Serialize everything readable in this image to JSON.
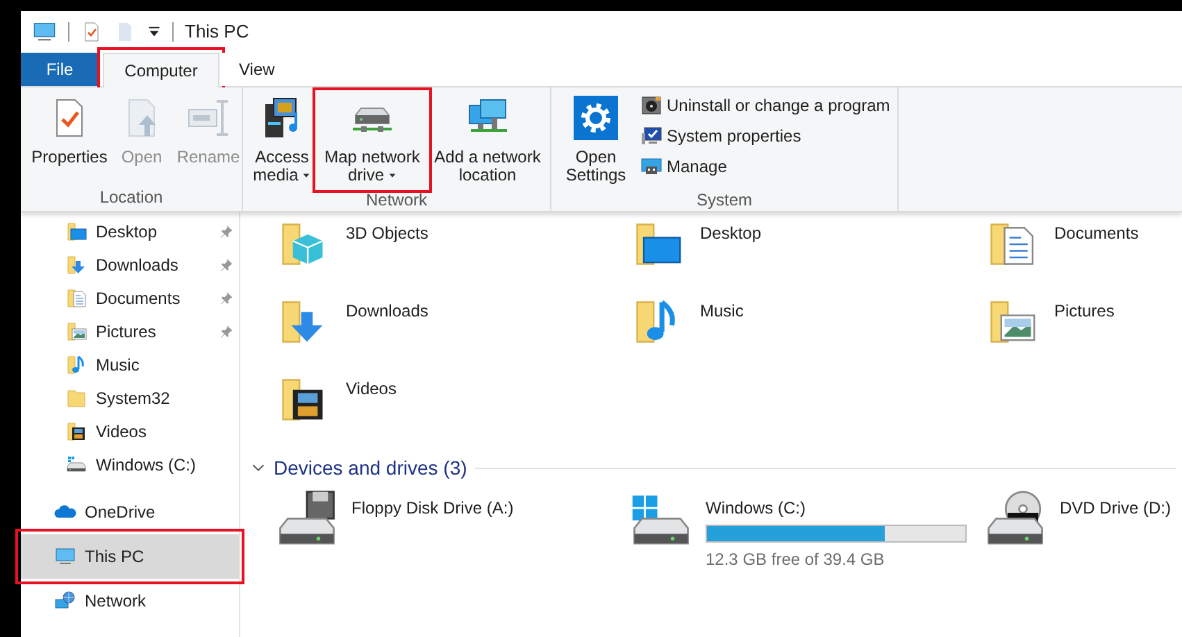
{
  "window": {
    "title": "This PC"
  },
  "tabs": [
    {
      "label": "File",
      "kind": "file",
      "selected": false,
      "highlighted": false
    },
    {
      "label": "Computer",
      "kind": "tab",
      "selected": true,
      "highlighted": true
    },
    {
      "label": "View",
      "kind": "tab",
      "selected": false,
      "highlighted": false
    }
  ],
  "ribbon_groups": [
    {
      "label": "Location",
      "commands": [
        {
          "label": "Properties",
          "kind": "large",
          "disabled": false,
          "dropdown": false,
          "highlighted": false
        },
        {
          "label": "Open",
          "kind": "large",
          "disabled": true,
          "dropdown": false,
          "highlighted": false
        },
        {
          "label": "Rename",
          "kind": "large",
          "disabled": true,
          "dropdown": false,
          "highlighted": false
        }
      ]
    },
    {
      "label": "Network",
      "commands": [
        {
          "label": "Access media",
          "kind": "large",
          "disabled": false,
          "dropdown": true,
          "highlighted": false
        },
        {
          "label": "Map network drive",
          "kind": "large",
          "disabled": false,
          "dropdown": true,
          "highlighted": true
        },
        {
          "label": "Add a network location",
          "kind": "large",
          "disabled": false,
          "dropdown": false,
          "highlighted": false
        }
      ]
    },
    {
      "label": "System",
      "commands": [
        {
          "label": "Open Settings",
          "kind": "large",
          "disabled": false,
          "dropdown": false,
          "highlighted": false
        },
        {
          "label": "Uninstall or change a program",
          "kind": "small",
          "disabled": false,
          "dropdown": false,
          "highlighted": false
        },
        {
          "label": "System properties",
          "kind": "small",
          "disabled": false,
          "dropdown": false,
          "highlighted": false
        },
        {
          "label": "Manage",
          "kind": "small",
          "disabled": false,
          "dropdown": false,
          "highlighted": false
        }
      ]
    }
  ],
  "navigation": {
    "quick_access": [
      {
        "label": "Desktop",
        "pinned": true
      },
      {
        "label": "Downloads",
        "pinned": true
      },
      {
        "label": "Documents",
        "pinned": true
      },
      {
        "label": "Pictures",
        "pinned": true
      },
      {
        "label": "Music",
        "pinned": false
      },
      {
        "label": "System32",
        "pinned": false
      },
      {
        "label": "Videos",
        "pinned": false
      },
      {
        "label": "Windows (C:)",
        "pinned": false
      }
    ],
    "locations": [
      {
        "label": "OneDrive",
        "selected": false,
        "highlighted": false
      },
      {
        "label": "This PC",
        "selected": true,
        "highlighted": true
      },
      {
        "label": "Network",
        "selected": false,
        "highlighted": false
      }
    ]
  },
  "folders": [
    {
      "label": "3D Objects"
    },
    {
      "label": "Desktop"
    },
    {
      "label": "Documents"
    },
    {
      "label": "Downloads"
    },
    {
      "label": "Music"
    },
    {
      "label": "Pictures"
    },
    {
      "label": "Videos"
    }
  ],
  "devices_section": {
    "title": "Devices and drives (3)",
    "expanded": true
  },
  "drives": [
    {
      "label": "Floppy Disk Drive (A:)",
      "kind": "plain"
    },
    {
      "label": "Windows (C:)",
      "kind": "usage",
      "level": 0.69,
      "free_text": "12.3 GB free of 39.4 GB"
    },
    {
      "label": "DVD Drive (D:)",
      "kind": "plain"
    }
  ]
}
